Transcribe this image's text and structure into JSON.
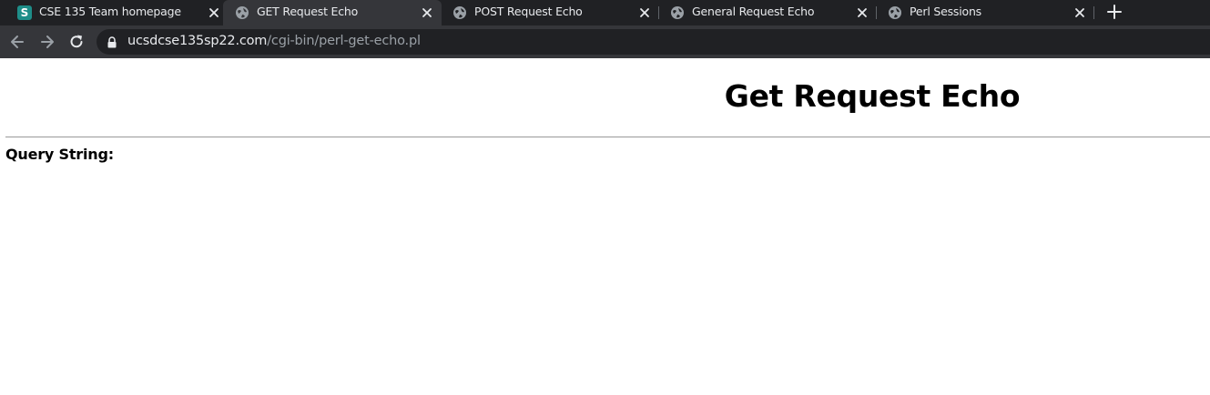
{
  "tabs": [
    {
      "title": "CSE 135 Team homepage",
      "favicon": "s-letter-icon",
      "active": false
    },
    {
      "title": "GET Request Echo",
      "favicon": "globe-icon",
      "active": true
    },
    {
      "title": "POST Request Echo",
      "favicon": "globe-icon",
      "active": false
    },
    {
      "title": "General Request Echo",
      "favicon": "globe-icon",
      "active": false
    },
    {
      "title": "Perl Sessions",
      "favicon": "globe-icon",
      "active": false
    }
  ],
  "favicon_letter": "S",
  "address_bar": {
    "host": "ucsdcse135sp22.com",
    "path": "/cgi-bin/perl-get-echo.pl"
  },
  "page": {
    "heading": "Get Request Echo",
    "query_label": "Query String:"
  },
  "colors": {
    "tabstrip_bg": "#202124",
    "active_tab_bg": "#35363a",
    "omnibox_bg": "#202124",
    "favicon_accent": "#1e8e89"
  }
}
